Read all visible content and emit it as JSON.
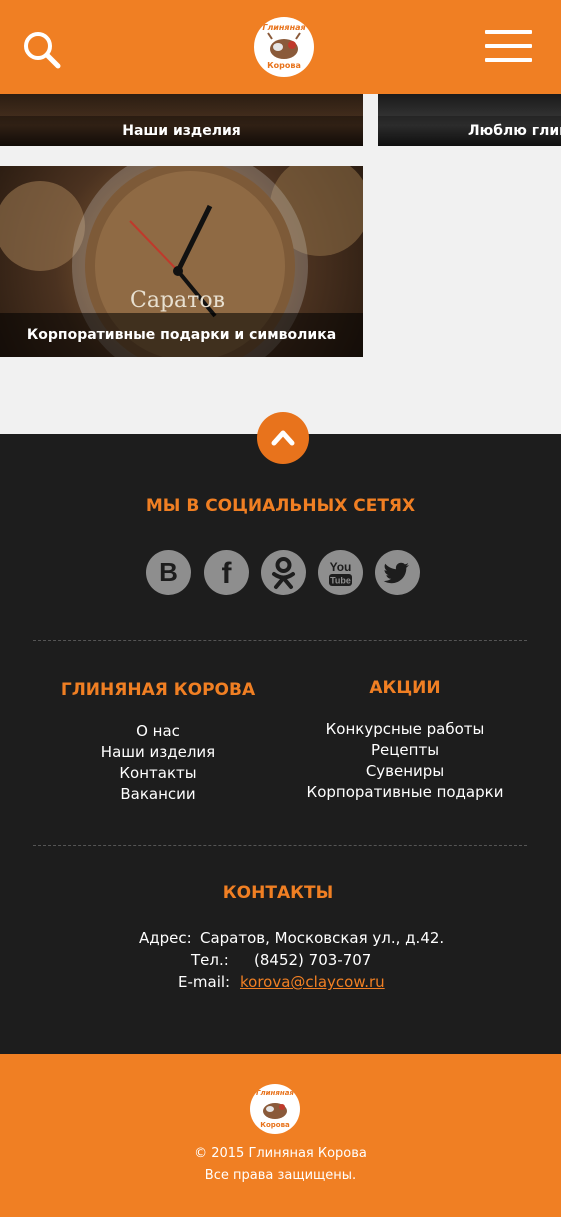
{
  "header": {
    "search_icon": "search-icon",
    "menu_icon": "hamburger-menu-icon",
    "logo_text_top": "Глиняная",
    "logo_text_bottom": "Корова"
  },
  "tiles": [
    {
      "label": "Наши изделия"
    },
    {
      "label": "Люблю глину"
    },
    {
      "label": "Корпоративные подарки и символика",
      "image_text": "Саратов"
    }
  ],
  "footer": {
    "social_title": "МЫ В СОЦИАЛЬНЫХ СЕТЯХ",
    "socials": [
      {
        "name": "vk-icon",
        "glyph": "B"
      },
      {
        "name": "facebook-icon",
        "glyph": "f"
      },
      {
        "name": "odnoklassniki-icon",
        "glyph": "ok"
      },
      {
        "name": "youtube-icon",
        "glyph_top": "You",
        "glyph_bottom": "Tube"
      },
      {
        "name": "twitter-icon",
        "glyph": "bird"
      }
    ],
    "col1": {
      "title": "ГЛИНЯНАЯ КОРОВА",
      "links": [
        "О нас",
        "Наши изделия",
        "Контакты",
        "Вакансии"
      ]
    },
    "col2": {
      "title": "АКЦИИ",
      "links": [
        "Конкурсные работы",
        "Рецепты",
        "Сувениры",
        "Корпоративные подарки"
      ]
    },
    "contacts": {
      "title": "КОНТАКТЫ",
      "address_label": "Адрес:",
      "address": "Саратов, Московская ул., д.42.",
      "phone_label": "Тел.:",
      "phone": "(8452) 703-707",
      "email_label": "E-mail:",
      "email": "korova@claycow.ru"
    }
  },
  "bottom": {
    "copyright": "© 2015 Глиняная Корова",
    "rights": "Все права защищены."
  },
  "colors": {
    "accent": "#f07f23",
    "dark": "#1d1d1d"
  }
}
